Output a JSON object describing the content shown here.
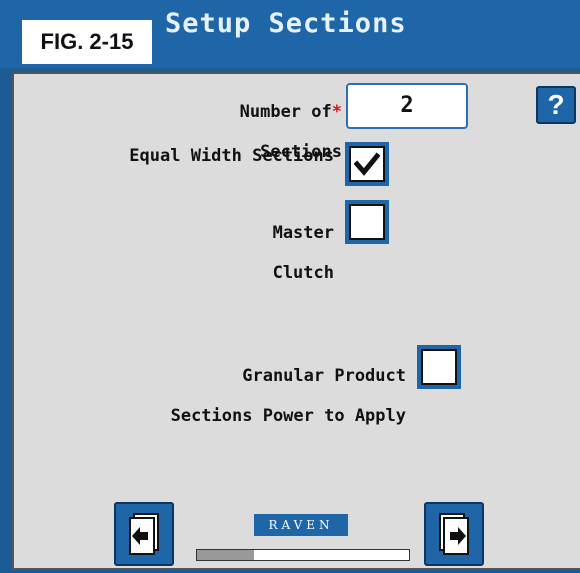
{
  "window": {
    "title": "Setup Sections"
  },
  "figure_label": "FIG. 2-15",
  "fields": {
    "number_of_sections": {
      "label_line1": "Number of",
      "label_line2": "Sections",
      "required_mark": "*",
      "value": "2"
    },
    "equal_width_sections": {
      "label": "Equal Width Sections",
      "checked": true
    },
    "master_clutch": {
      "label_line1": "Master",
      "label_line2": "Clutch",
      "checked": false
    },
    "granular_product": {
      "label_line1": "Granular Product",
      "label_line2": "Sections Power to Apply",
      "checked": false
    }
  },
  "help_button": {
    "label": "?"
  },
  "logo_text": "RAVEN",
  "progress": {
    "fraction": 0.27
  },
  "colors": {
    "accent": "#1f66a8",
    "panel": "#dcdcdc",
    "required": "#d11"
  },
  "icons": {
    "back": "page-back-icon",
    "next": "page-forward-icon"
  }
}
